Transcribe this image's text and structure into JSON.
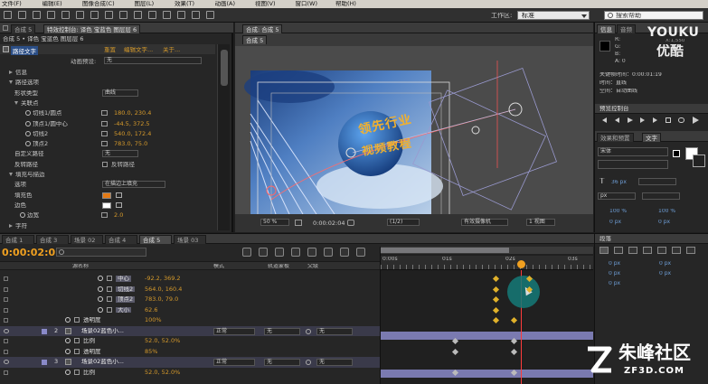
{
  "menubar": {
    "items": [
      "文件(F)",
      "编辑(E)",
      "图像合成(C)",
      "图层(L)",
      "效果(T)",
      "动画(A)",
      "视图(V)",
      "窗口(W)",
      "帮助(H)"
    ],
    "workspace_label": "工作区:",
    "workspace_value": "标准",
    "search_placeholder": "搜索帮助"
  },
  "effect_controls": {
    "header_tab": "特效控制台: 译色 宝蓝色 图层层 6",
    "header_tab_short": "合成 5",
    "subheader": "合成 5 • 译色 宝蓝色 图层层 6",
    "fx_name": "路径文字",
    "fx_links": [
      "重置",
      "编辑文字...",
      "关于..."
    ],
    "preset_label": "动画预设:",
    "preset_value": "无",
    "rows": [
      {
        "label": "信息",
        "indent": 1,
        "tri": "right"
      },
      {
        "label": "路径选项",
        "indent": 1,
        "tri": "down"
      },
      {
        "label": "形状类型",
        "indent": 2,
        "value": "曲线",
        "combo": true
      },
      {
        "label": "关联点",
        "indent": 2,
        "tri": "down"
      },
      {
        "label": "切线1/圆点",
        "indent": 3,
        "value": "180.0, 230.4",
        "stopwatch": true
      },
      {
        "label": "顶点1/圆中心",
        "indent": 3,
        "value": "-44.5, 372.5",
        "stopwatch": true
      },
      {
        "label": "切线2",
        "indent": 3,
        "value": "540.0, 172.4",
        "stopwatch": true
      },
      {
        "label": "顶点2",
        "indent": 3,
        "value": "783.0, 75.0",
        "stopwatch": true
      },
      {
        "label": "自定义路径",
        "indent": 2,
        "value": "无",
        "combo": true
      },
      {
        "label": "反转路径",
        "indent": 2,
        "value": "反转路径",
        "checkbox": true
      },
      {
        "label": "填充与描边",
        "indent": 1,
        "tri": "down"
      },
      {
        "label": "选项",
        "indent": 2,
        "value": "在描边上填充",
        "combo": true
      },
      {
        "label": "填充色",
        "indent": 2,
        "swatch": "#e37a16"
      },
      {
        "label": "边色",
        "indent": 2,
        "swatch": "#ffffff"
      },
      {
        "label": "边宽",
        "indent": 2,
        "value": "2.0",
        "stopwatch": true
      },
      {
        "label": "字符",
        "indent": 1,
        "tri": "right"
      }
    ]
  },
  "composition": {
    "header_tab": "合成: 合成 5",
    "sub_tab": "合成 5",
    "video_text_line1": "领先行业",
    "video_text_line2": "视频教程",
    "footer": {
      "zoom": "50 %",
      "timecode": "0:00:02:04",
      "resolution": "(1/2)",
      "camera": "有效摄像机",
      "views": "1 视图"
    },
    "colors": {
      "sky": "#5f8fce",
      "text": "#f0b030"
    }
  },
  "youku": {
    "logo": "YOUKU",
    "logo_sub": "优酷",
    "res": "X:1,550"
  },
  "info_panel": {
    "tabs": [
      "信息",
      "音频"
    ],
    "labels": [
      "R:",
      "G:",
      "B:",
      "A: 0"
    ],
    "info_lines": [
      "关键帧时间：0:00:01:19",
      "时间：直线",
      "空间：自动曲线"
    ]
  },
  "preview_panel": {
    "title": "预览控制台"
  },
  "effects_panel": {
    "tabs": [
      "效果和预置",
      "文字"
    ],
    "font": "宋体",
    "size_value": "36 px",
    "px_label": "px",
    "percent_values": [
      "100 %",
      "100 %"
    ],
    "px_values": [
      "0 px",
      "0 px"
    ]
  },
  "paragraph_panel": {
    "title": "段落",
    "values": [
      "0 px",
      "0 px",
      "0 px",
      "0 px",
      "0 px"
    ]
  },
  "timeline": {
    "tabs": [
      "合成 1",
      "合成 3",
      "场景 02",
      "合成 4",
      "合成 5",
      "场景 03"
    ],
    "timecode": "0:00:02:05",
    "search_placeholder": "",
    "col_headers": [
      "源名称",
      "模式",
      "轨道蒙板",
      "父级"
    ],
    "ruler": [
      "0:00s",
      "01s",
      "02s",
      "03s"
    ],
    "layers": [
      {
        "name": "中心",
        "value": "-92.2, 369.2",
        "kind": "sub"
      },
      {
        "name": "切线2",
        "value": "564.0, 160.4",
        "kind": "sub"
      },
      {
        "name": "顶点2",
        "value": "783.0, 79.0",
        "kind": "sub"
      },
      {
        "name": "大小",
        "value": "62.6",
        "kind": "sub"
      },
      {
        "name": "透明度",
        "value": "100%",
        "kind": "sub2"
      },
      {
        "num": "2",
        "name": "场景02蓝色小...",
        "mode": "正常",
        "track": "无",
        "parent": "无",
        "kind": "layer"
      },
      {
        "name": "比例",
        "value": "52.0, 52.0%",
        "kind": "sub2"
      },
      {
        "name": "透明度",
        "value": "85%",
        "kind": "sub2"
      },
      {
        "num": "3",
        "name": "场景02蓝色小...",
        "mode": "正常",
        "track": "无",
        "parent": "无",
        "kind": "layer"
      },
      {
        "name": "比例",
        "value": "52.0, 52.0%",
        "kind": "sub2"
      }
    ]
  },
  "watermark": {
    "brand": "朱峰社区",
    "url": "ZF3D.COM"
  }
}
